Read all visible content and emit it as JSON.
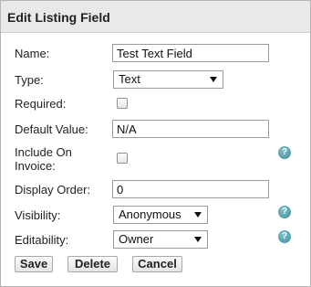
{
  "title": "Edit Listing Field",
  "fields": {
    "name": {
      "label": "Name:",
      "value": "Test Text Field"
    },
    "type": {
      "label": "Type:",
      "value": "Text"
    },
    "required": {
      "label": "Required:",
      "checked": false
    },
    "default_value": {
      "label": "Default Value:",
      "value": "N/A"
    },
    "include_on_invoice": {
      "label_line1": "Include On",
      "label_line2": "Invoice:",
      "checked": false
    },
    "display_order": {
      "label": "Display Order:",
      "value": "0"
    },
    "visibility": {
      "label": "Visibility:",
      "value": "Anonymous"
    },
    "editability": {
      "label": "Editability:",
      "value": "Owner"
    }
  },
  "help_glyph": "?",
  "help_icon_color": "#4a9aa6",
  "buttons": {
    "save": "Save",
    "delete": "Delete",
    "cancel": "Cancel"
  }
}
